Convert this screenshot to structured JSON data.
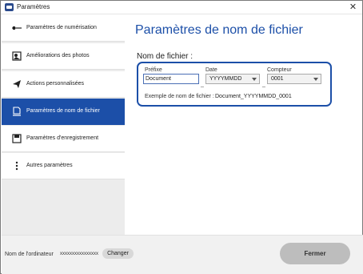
{
  "window": {
    "title": "Paramètres"
  },
  "sidebar": {
    "items": [
      {
        "label": "Paramètres de numérisation",
        "icon": "scan-settings-icon"
      },
      {
        "label": "Améliorations des photos",
        "icon": "photo-enhance-icon"
      },
      {
        "label": "Actions personnalisées",
        "icon": "send-icon"
      },
      {
        "label": "Paramètres de nom de fichier",
        "icon": "file-name-icon",
        "active": true
      },
      {
        "label": "Paramètres d'enregistrement",
        "icon": "save-settings-icon"
      },
      {
        "label": "Autres paramètres",
        "icon": "more-vertical-icon"
      }
    ]
  },
  "main": {
    "title": "Paramètres de nom de fichier",
    "section_label": "Nom de fichier :",
    "prefix_label": "Préfixe",
    "prefix_value": "Document",
    "date_label": "Date",
    "date_value": "YYYYMMDD",
    "counter_label": "Compteur",
    "counter_value": "0001",
    "separator": "_",
    "example_label": "Exemple de nom de fichier :",
    "example_value": "Document_YYYYMMDD_0001"
  },
  "footer": {
    "computer_label": "Nom de l'ordinateur",
    "computer_value": "xxxxxxxxxxxxxxxx",
    "change_label": "Changer",
    "close_label": "Fermer"
  },
  "colors": {
    "accent": "#1c4fa8",
    "sidebar_bg": "#ececec",
    "footer_bg": "#f1f1f1"
  }
}
